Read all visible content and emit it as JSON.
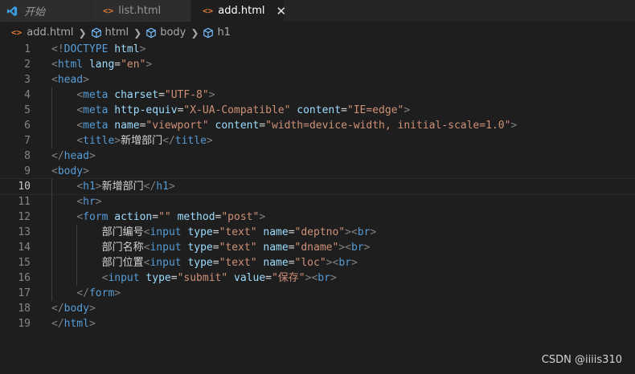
{
  "tabs": [
    {
      "label": "开始",
      "icon": "vscode-icon"
    },
    {
      "label": "list.html",
      "icon": "html-file-icon"
    },
    {
      "label": "add.html",
      "icon": "html-file-icon",
      "active": true
    }
  ],
  "breadcrumb": [
    "add.html",
    "html",
    "body",
    "h1"
  ],
  "current_line": 10,
  "lines": [
    {
      "n": "1",
      "indent": 0,
      "tokens": [
        [
          "p",
          "<!"
        ],
        [
          "t",
          "DOCTYPE"
        ],
        [
          "x",
          " "
        ],
        [
          "a",
          "html"
        ],
        [
          "p",
          ">"
        ]
      ]
    },
    {
      "n": "2",
      "indent": 0,
      "tokens": [
        [
          "p",
          "<"
        ],
        [
          "t",
          "html"
        ],
        [
          "x",
          " "
        ],
        [
          "a",
          "lang"
        ],
        [
          "x",
          "="
        ],
        [
          "s",
          "\"en\""
        ],
        [
          "p",
          ">"
        ]
      ]
    },
    {
      "n": "3",
      "indent": 0,
      "tokens": [
        [
          "p",
          "<"
        ],
        [
          "t",
          "head"
        ],
        [
          "p",
          ">"
        ]
      ]
    },
    {
      "n": "4",
      "indent": 1,
      "tokens": [
        [
          "p",
          "<"
        ],
        [
          "t",
          "meta"
        ],
        [
          "x",
          " "
        ],
        [
          "a",
          "charset"
        ],
        [
          "x",
          "="
        ],
        [
          "s",
          "\"UTF-8\""
        ],
        [
          "p",
          ">"
        ]
      ]
    },
    {
      "n": "5",
      "indent": 1,
      "tokens": [
        [
          "p",
          "<"
        ],
        [
          "t",
          "meta"
        ],
        [
          "x",
          " "
        ],
        [
          "a",
          "http-equiv"
        ],
        [
          "x",
          "="
        ],
        [
          "s",
          "\"X-UA-Compatible\""
        ],
        [
          "x",
          " "
        ],
        [
          "a",
          "content"
        ],
        [
          "x",
          "="
        ],
        [
          "s",
          "\"IE=edge\""
        ],
        [
          "p",
          ">"
        ]
      ]
    },
    {
      "n": "6",
      "indent": 1,
      "tokens": [
        [
          "p",
          "<"
        ],
        [
          "t",
          "meta"
        ],
        [
          "x",
          " "
        ],
        [
          "a",
          "name"
        ],
        [
          "x",
          "="
        ],
        [
          "s",
          "\"viewport\""
        ],
        [
          "x",
          " "
        ],
        [
          "a",
          "content"
        ],
        [
          "x",
          "="
        ],
        [
          "s",
          "\"width=device-width, initial-scale=1.0\""
        ],
        [
          "p",
          ">"
        ]
      ]
    },
    {
      "n": "7",
      "indent": 1,
      "tokens": [
        [
          "p",
          "<"
        ],
        [
          "t",
          "title"
        ],
        [
          "p",
          ">"
        ],
        [
          "x",
          "新增部门"
        ],
        [
          "p",
          "</"
        ],
        [
          "t",
          "title"
        ],
        [
          "p",
          ">"
        ]
      ]
    },
    {
      "n": "8",
      "indent": 0,
      "tokens": [
        [
          "p",
          "</"
        ],
        [
          "t",
          "head"
        ],
        [
          "p",
          ">"
        ]
      ]
    },
    {
      "n": "9",
      "indent": 0,
      "tokens": [
        [
          "p",
          "<"
        ],
        [
          "t",
          "body"
        ],
        [
          "p",
          ">"
        ]
      ]
    },
    {
      "n": "10",
      "indent": 1,
      "tokens": [
        [
          "p",
          "<"
        ],
        [
          "t",
          "h1"
        ],
        [
          "p",
          ">"
        ],
        [
          "x",
          "新增部门"
        ],
        [
          "p",
          "</"
        ],
        [
          "t",
          "h1"
        ],
        [
          "p",
          ">"
        ]
      ]
    },
    {
      "n": "11",
      "indent": 1,
      "tokens": [
        [
          "p",
          "<"
        ],
        [
          "t",
          "hr"
        ],
        [
          "p",
          ">"
        ]
      ]
    },
    {
      "n": "12",
      "indent": 1,
      "tokens": [
        [
          "p",
          "<"
        ],
        [
          "t",
          "form"
        ],
        [
          "x",
          " "
        ],
        [
          "a",
          "action"
        ],
        [
          "x",
          "="
        ],
        [
          "s",
          "\"\""
        ],
        [
          "x",
          " "
        ],
        [
          "a",
          "method"
        ],
        [
          "x",
          "="
        ],
        [
          "s",
          "\"post\""
        ],
        [
          "p",
          ">"
        ]
      ]
    },
    {
      "n": "13",
      "indent": 2,
      "tokens": [
        [
          "x",
          "部门编号"
        ],
        [
          "p",
          "<"
        ],
        [
          "t",
          "input"
        ],
        [
          "x",
          " "
        ],
        [
          "a",
          "type"
        ],
        [
          "x",
          "="
        ],
        [
          "s",
          "\"text\""
        ],
        [
          "x",
          " "
        ],
        [
          "a",
          "name"
        ],
        [
          "x",
          "="
        ],
        [
          "s",
          "\"deptno\""
        ],
        [
          "p",
          "><"
        ],
        [
          "t",
          "br"
        ],
        [
          "p",
          ">"
        ]
      ]
    },
    {
      "n": "14",
      "indent": 2,
      "tokens": [
        [
          "x",
          "部门名称"
        ],
        [
          "p",
          "<"
        ],
        [
          "t",
          "input"
        ],
        [
          "x",
          " "
        ],
        [
          "a",
          "type"
        ],
        [
          "x",
          "="
        ],
        [
          "s",
          "\"text\""
        ],
        [
          "x",
          " "
        ],
        [
          "a",
          "name"
        ],
        [
          "x",
          "="
        ],
        [
          "s",
          "\"dname\""
        ],
        [
          "p",
          "><"
        ],
        [
          "t",
          "br"
        ],
        [
          "p",
          ">"
        ]
      ]
    },
    {
      "n": "15",
      "indent": 2,
      "tokens": [
        [
          "x",
          "部门位置"
        ],
        [
          "p",
          "<"
        ],
        [
          "t",
          "input"
        ],
        [
          "x",
          " "
        ],
        [
          "a",
          "type"
        ],
        [
          "x",
          "="
        ],
        [
          "s",
          "\"text\""
        ],
        [
          "x",
          " "
        ],
        [
          "a",
          "name"
        ],
        [
          "x",
          "="
        ],
        [
          "s",
          "\"loc\""
        ],
        [
          "p",
          "><"
        ],
        [
          "t",
          "br"
        ],
        [
          "p",
          ">"
        ]
      ]
    },
    {
      "n": "16",
      "indent": 2,
      "tokens": [
        [
          "p",
          "<"
        ],
        [
          "t",
          "input"
        ],
        [
          "x",
          " "
        ],
        [
          "a",
          "type"
        ],
        [
          "x",
          "="
        ],
        [
          "s",
          "\"submit\""
        ],
        [
          "x",
          " "
        ],
        [
          "a",
          "value"
        ],
        [
          "x",
          "="
        ],
        [
          "s",
          "\"保存\""
        ],
        [
          "p",
          "><"
        ],
        [
          "t",
          "br"
        ],
        [
          "p",
          ">"
        ]
      ]
    },
    {
      "n": "17",
      "indent": 1,
      "tokens": [
        [
          "p",
          "</"
        ],
        [
          "t",
          "form"
        ],
        [
          "p",
          ">"
        ]
      ]
    },
    {
      "n": "18",
      "indent": 0,
      "tokens": [
        [
          "p",
          "</"
        ],
        [
          "t",
          "body"
        ],
        [
          "p",
          ">"
        ]
      ]
    },
    {
      "n": "19",
      "indent": 0,
      "tokens": [
        [
          "p",
          "</"
        ],
        [
          "t",
          "html"
        ],
        [
          "p",
          ">"
        ]
      ]
    }
  ],
  "watermark": "CSDN @iiiis310",
  "colors": {
    "tag": "#569cd6",
    "attr": "#9cdcfe",
    "string": "#ce9178",
    "punct": "#808080",
    "text": "#d4d4d4",
    "html_icon": "#e37933",
    "vscode_icon": "#3b9ddd"
  }
}
